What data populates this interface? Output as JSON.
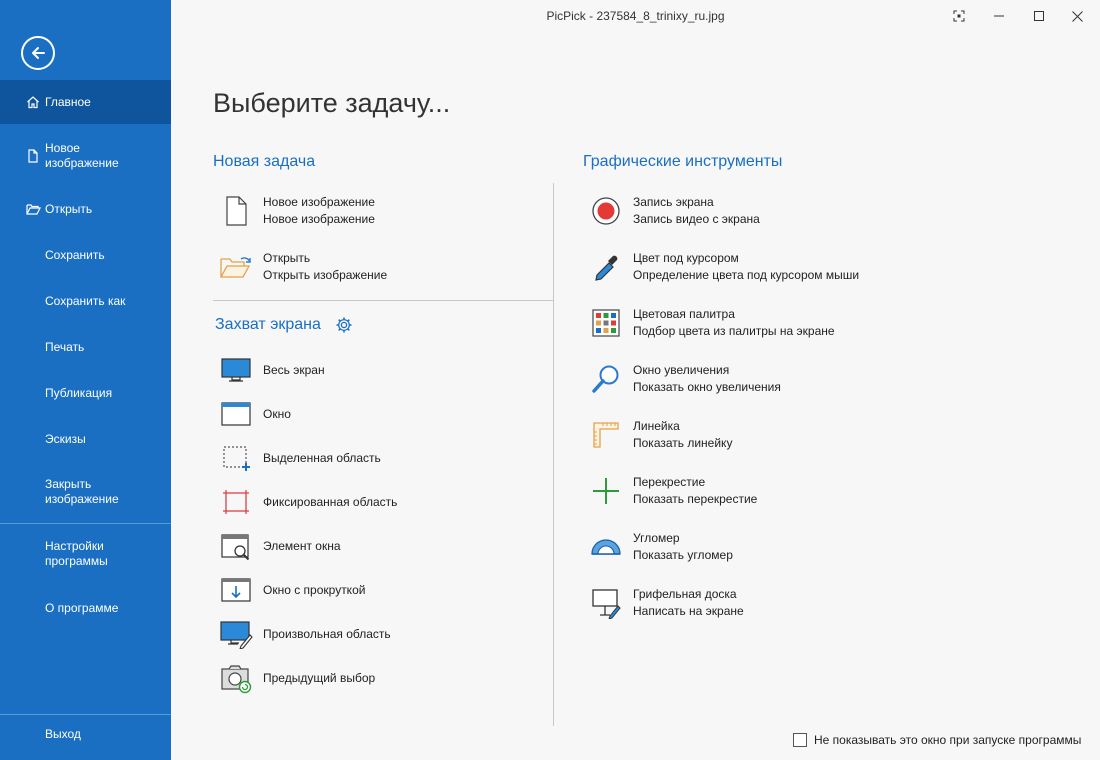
{
  "window": {
    "title": "PicPick - 237584_8_trinixy_ru.jpg"
  },
  "sidebar": {
    "items": [
      {
        "label": "Главное",
        "icon": "home-icon"
      },
      {
        "label": "Новое\nизображение",
        "icon": "new-file-icon"
      },
      {
        "label": "Открыть",
        "icon": "folder-open-icon"
      },
      {
        "label": "Сохранить"
      },
      {
        "label": "Сохранить как"
      },
      {
        "label": "Печать"
      },
      {
        "label": "Публикация"
      },
      {
        "label": "Эскизы"
      },
      {
        "label": "Закрыть\nизображение"
      },
      {
        "label": "Настройки\nпрограммы"
      },
      {
        "label": "О программе"
      },
      {
        "label": "Выход"
      }
    ]
  },
  "main": {
    "page_title": "Выберите задачу...",
    "new_task": {
      "title": "Новая задача",
      "items": [
        {
          "title": "Новое изображение",
          "subtitle": "Новое изображение",
          "icon": "blank-page-icon"
        },
        {
          "title": "Открыть",
          "subtitle": "Открыть изображение",
          "icon": "open-folder-icon"
        }
      ]
    },
    "capture": {
      "title": "Захват экрана",
      "items": [
        {
          "label": "Весь экран",
          "icon": "full-screen-icon"
        },
        {
          "label": "Окно",
          "icon": "window-icon"
        },
        {
          "label": "Выделенная область",
          "icon": "region-select-icon"
        },
        {
          "label": "Фиксированная область",
          "icon": "fixed-region-icon"
        },
        {
          "label": "Элемент окна",
          "icon": "window-element-icon"
        },
        {
          "label": "Окно с прокруткой",
          "icon": "scroll-window-icon"
        },
        {
          "label": "Произвольная область",
          "icon": "freehand-region-icon"
        },
        {
          "label": "Предыдущий выбор",
          "icon": "repeat-capture-icon"
        }
      ]
    },
    "tools": {
      "title": "Графические инструменты",
      "items": [
        {
          "title": "Запись экрана",
          "subtitle": "Запись видео с экрана",
          "icon": "record-icon"
        },
        {
          "title": "Цвет под курсором",
          "subtitle": "Определение цвета под курсором мыши",
          "icon": "eyedropper-icon"
        },
        {
          "title": "Цветовая палитра",
          "subtitle": "Подбор цвета из палитры на экране",
          "icon": "palette-icon"
        },
        {
          "title": "Окно увеличения",
          "subtitle": "Показать окно увеличения",
          "icon": "magnifier-icon"
        },
        {
          "title": "Линейка",
          "subtitle": "Показать линейку",
          "icon": "ruler-icon"
        },
        {
          "title": "Перекрестие",
          "subtitle": "Показать перекрестие",
          "icon": "crosshair-icon"
        },
        {
          "title": "Угломер",
          "subtitle": "Показать угломер",
          "icon": "protractor-icon"
        },
        {
          "title": "Грифельная доска",
          "subtitle": "Написать на экране",
          "icon": "whiteboard-icon"
        }
      ]
    }
  },
  "footer": {
    "checkbox_label": "Не показывать это окно при запуске программы",
    "checked": false
  },
  "colors": {
    "sidebar": "#1a6fc2",
    "sidebar_active": "#0f559d",
    "accent": "#1a6fc2",
    "record_red": "#e53935",
    "crosshair_green": "#2e9b3a",
    "ruler_orange": "#e3a24a"
  }
}
